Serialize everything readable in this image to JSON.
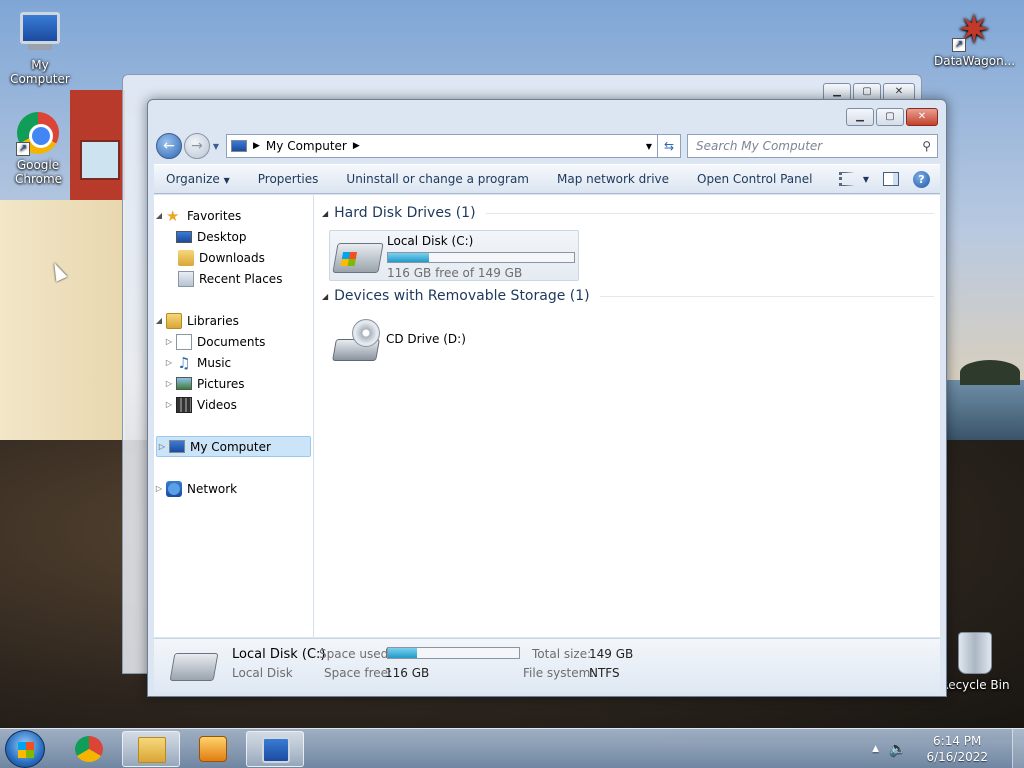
{
  "desktop": {
    "icons": [
      {
        "label": "My Computer"
      },
      {
        "label": "Google Chrome"
      },
      {
        "label": "DataWagon..."
      },
      {
        "label": "Recycle Bin"
      }
    ]
  },
  "window": {
    "address": {
      "crumb": "My Computer",
      "search_placeholder": "Search My Computer"
    },
    "toolbar": {
      "organize": "Organize",
      "properties": "Properties",
      "uninstall": "Uninstall or change a program",
      "map_drive": "Map network drive",
      "control_panel": "Open Control Panel",
      "help": "?"
    },
    "nav": {
      "favorites": "Favorites",
      "desktop": "Desktop",
      "downloads": "Downloads",
      "recent": "Recent Places",
      "libraries": "Libraries",
      "documents": "Documents",
      "music": "Music",
      "pictures": "Pictures",
      "videos": "Videos",
      "computer": "My Computer",
      "network": "Network"
    },
    "groups": {
      "hdd": "Hard Disk Drives (1)",
      "removable": "Devices with Removable Storage (1)"
    },
    "drives": {
      "c_name": "Local Disk (C:)",
      "c_free": "116 GB free of 149 GB",
      "c_used_fraction": 0.22,
      "d_name": "CD Drive (D:)"
    },
    "details": {
      "name": "Local Disk (C:)",
      "type": "Local Disk",
      "space_used_label": "Space used:",
      "space_free_label": "Space free:",
      "space_free_value": "116 GB",
      "total_label": "Total size:",
      "total_value": "149 GB",
      "fs_label": "File system:",
      "fs_value": "NTFS"
    }
  },
  "taskbar": {
    "time": "6:14 PM",
    "date": "6/16/2022"
  },
  "colors": {
    "progress": "#1e9bc9",
    "selection": "#cce4f7",
    "link_text": "#1e395b"
  }
}
